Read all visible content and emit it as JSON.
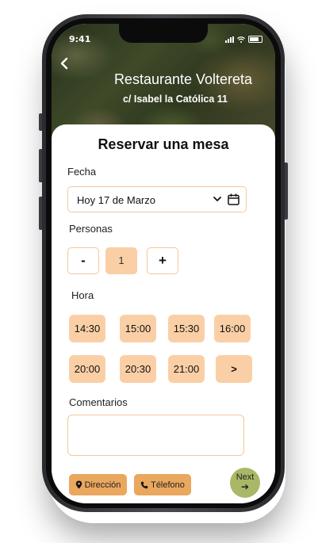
{
  "status": {
    "time": "9:41"
  },
  "header": {
    "back_icon": "chevron-left-icon",
    "restaurant_name": "Restaurante Voltereta",
    "address": "c/ Isabel la Católica 11"
  },
  "form": {
    "title": "Reservar una mesa",
    "date_label": "Fecha",
    "date_value": "Hoy 17 de Marzo",
    "people_label": "Personas",
    "decrement_label": "-",
    "quantity": "1",
    "increment_label": "+",
    "time_label": "Hora",
    "time_slots": [
      "14:30",
      "15:00",
      "15:30",
      "16:00",
      "20:00",
      "20:30",
      "21:00"
    ],
    "more_slots_label": ">",
    "comments_label": "Comentarios"
  },
  "footer": {
    "direction_label": "Dirección",
    "phone_label": "Télefono",
    "next_label": "Next",
    "next_arrow": "➔"
  },
  "colors": {
    "accent": "#fbcfa6",
    "border": "#f5c79b",
    "pill": "#eaa75e",
    "next": "#a8b866"
  }
}
